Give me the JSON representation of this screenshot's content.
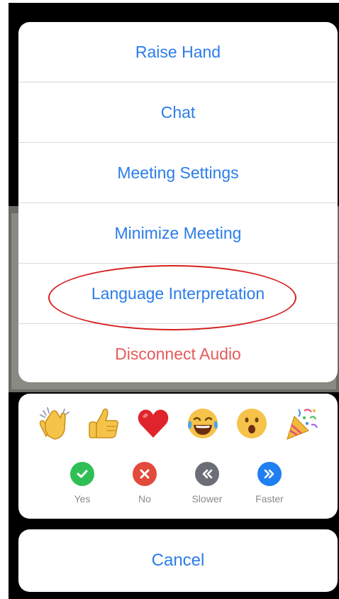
{
  "menu": {
    "items": [
      {
        "label": "Raise Hand"
      },
      {
        "label": "Chat"
      },
      {
        "label": "Meeting Settings"
      },
      {
        "label": "Minimize Meeting"
      },
      {
        "label": "Language Interpretation"
      },
      {
        "label": "Disconnect Audio"
      }
    ]
  },
  "reactions": {
    "emojis": [
      {
        "icon": "clapping-hands-icon",
        "color": "#f6c34a"
      },
      {
        "icon": "thumbs-up-icon",
        "color": "#f6c34a"
      },
      {
        "icon": "red-heart-icon",
        "color": "#e0242c"
      },
      {
        "icon": "tears-of-joy-icon",
        "color": "#f6c34a"
      },
      {
        "icon": "surprised-face-icon",
        "color": "#f6c34a"
      },
      {
        "icon": "party-popper-icon",
        "color": "#f2b93b"
      }
    ],
    "feedback": [
      {
        "label": "Yes",
        "icon": "check-icon",
        "color": "#2fbf55"
      },
      {
        "label": "No",
        "icon": "x-icon",
        "color": "#e24a3b"
      },
      {
        "label": "Slower",
        "icon": "rewind-icon",
        "color": "#6b6e76"
      },
      {
        "label": "Faster",
        "icon": "fast-forward-icon",
        "color": "#1f7ef0"
      }
    ]
  },
  "cancel": {
    "label": "Cancel"
  },
  "colors": {
    "accent": "#2b7de9",
    "destructive": "#e55a5a",
    "highlight": "#d61f1f"
  }
}
